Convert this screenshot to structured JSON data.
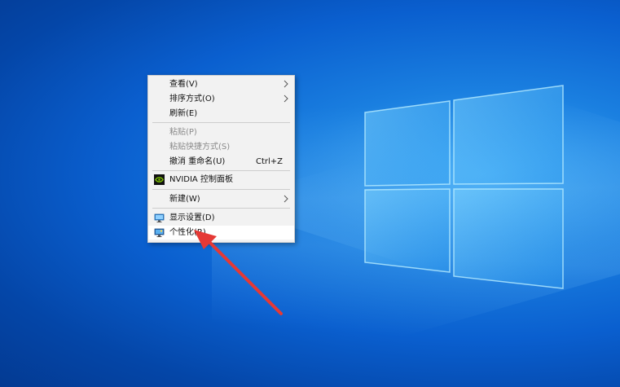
{
  "desktop": {
    "background_color": "#0a5fcf"
  },
  "menu": {
    "view_label": "查看(V)",
    "sort_label": "排序方式(O)",
    "refresh_label": "刷新(E)",
    "paste_label": "粘贴(P)",
    "paste_shortcut_label": "粘贴快捷方式(S)",
    "undo_label": "撤消 重命名(U)",
    "undo_shortcut": "Ctrl+Z",
    "nvidia_label": "NVIDIA 控制面板",
    "new_label": "新建(W)",
    "display_label": "显示设置(D)",
    "personalize_label": "个性化(R)"
  },
  "annotation": {
    "arrow_color": "#e53935"
  }
}
